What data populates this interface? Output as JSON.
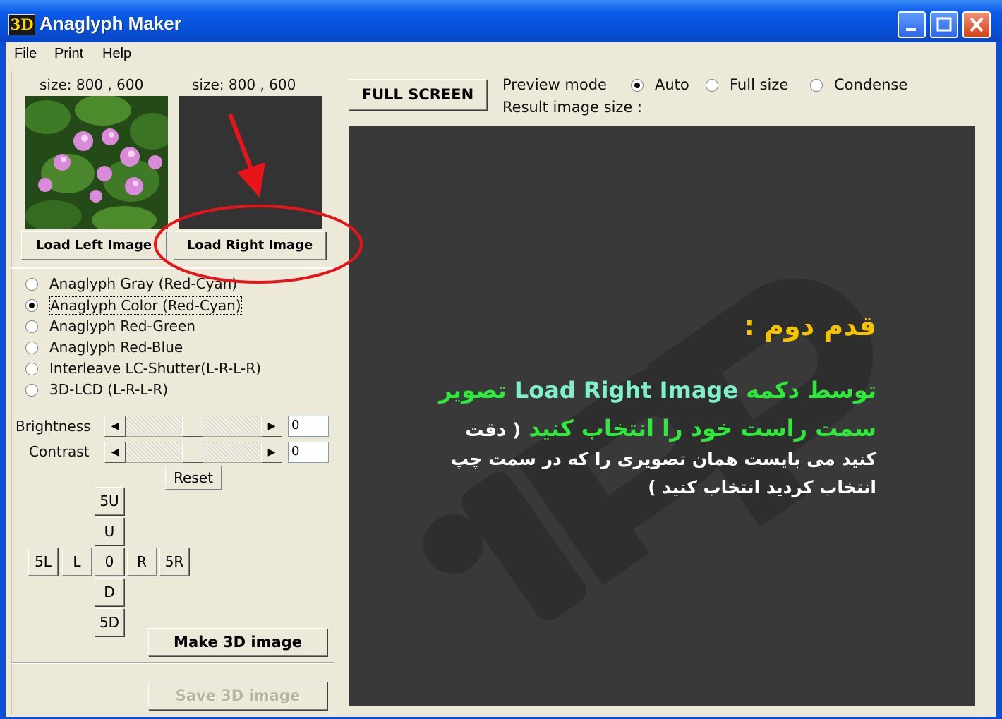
{
  "window": {
    "app_icon_text": "3D",
    "title": "Anaglyph Maker",
    "minimize_icon": "minimize-icon",
    "maximize_icon": "maximize-icon",
    "close_icon": "close-icon"
  },
  "menu": [
    "File",
    "Print",
    "Help"
  ],
  "left": {
    "left_size": "size: 800 , 600",
    "right_size": "size: 800 , 600",
    "load_left": "Load Left Image",
    "load_right": "Load Right Image",
    "modes": [
      {
        "label": "Anaglyph Gray (Red-Cyan)",
        "checked": false
      },
      {
        "label": "Anaglyph Color (Red-Cyan)",
        "checked": true
      },
      {
        "label": "Anaglyph Red-Green",
        "checked": false
      },
      {
        "label": "Anaglyph Red-Blue",
        "checked": false
      },
      {
        "label": "Interleave LC-Shutter(L-R-L-R)",
        "checked": false
      },
      {
        "label": "3D-LCD (L-R-L-R)",
        "checked": false
      }
    ],
    "brightness_label": "Brightness",
    "brightness_value": "0",
    "contrast_label": "Contrast",
    "contrast_value": "0",
    "reset": "Reset",
    "nav": {
      "up5": "5U",
      "up": "U",
      "left5": "5L",
      "left": "L",
      "center": "0",
      "right": "R",
      "right5": "5R",
      "down": "D",
      "down5": "5D"
    },
    "make_3d": "Make 3D image",
    "save_3d": "Save 3D image"
  },
  "right": {
    "full_screen": "FULL SCREEN",
    "preview_mode_label": "Preview mode",
    "preview_modes": [
      {
        "label": "Auto",
        "checked": true
      },
      {
        "label": "Full size",
        "checked": false
      },
      {
        "label": "Condense",
        "checked": false
      }
    ],
    "result_size_label": "Result image size :"
  },
  "overlay": {
    "step_title": "قدم دوم :",
    "line1_part1": "توسط دکمه",
    "line1_button": "Load Right Image",
    "line1_part2": "تصویر",
    "line2_green": "سمت راست خود را انتخاب کنید",
    "line2_white": "( دقت",
    "line3": "کنید می بایست همان تصویری را که در سمت چپ",
    "line4": "انتخاب کردید انتخاب کنید )",
    "watermark": "iSP"
  },
  "colors": {
    "title_bar": "#0a5ae8",
    "panel_bg": "#ece9d8",
    "preview_bg": "#393939",
    "step_title": "#f5c400",
    "green_text": "#2ee83a",
    "cyan_text": "#7ff0c8",
    "annotation_red": "#e8141a"
  }
}
